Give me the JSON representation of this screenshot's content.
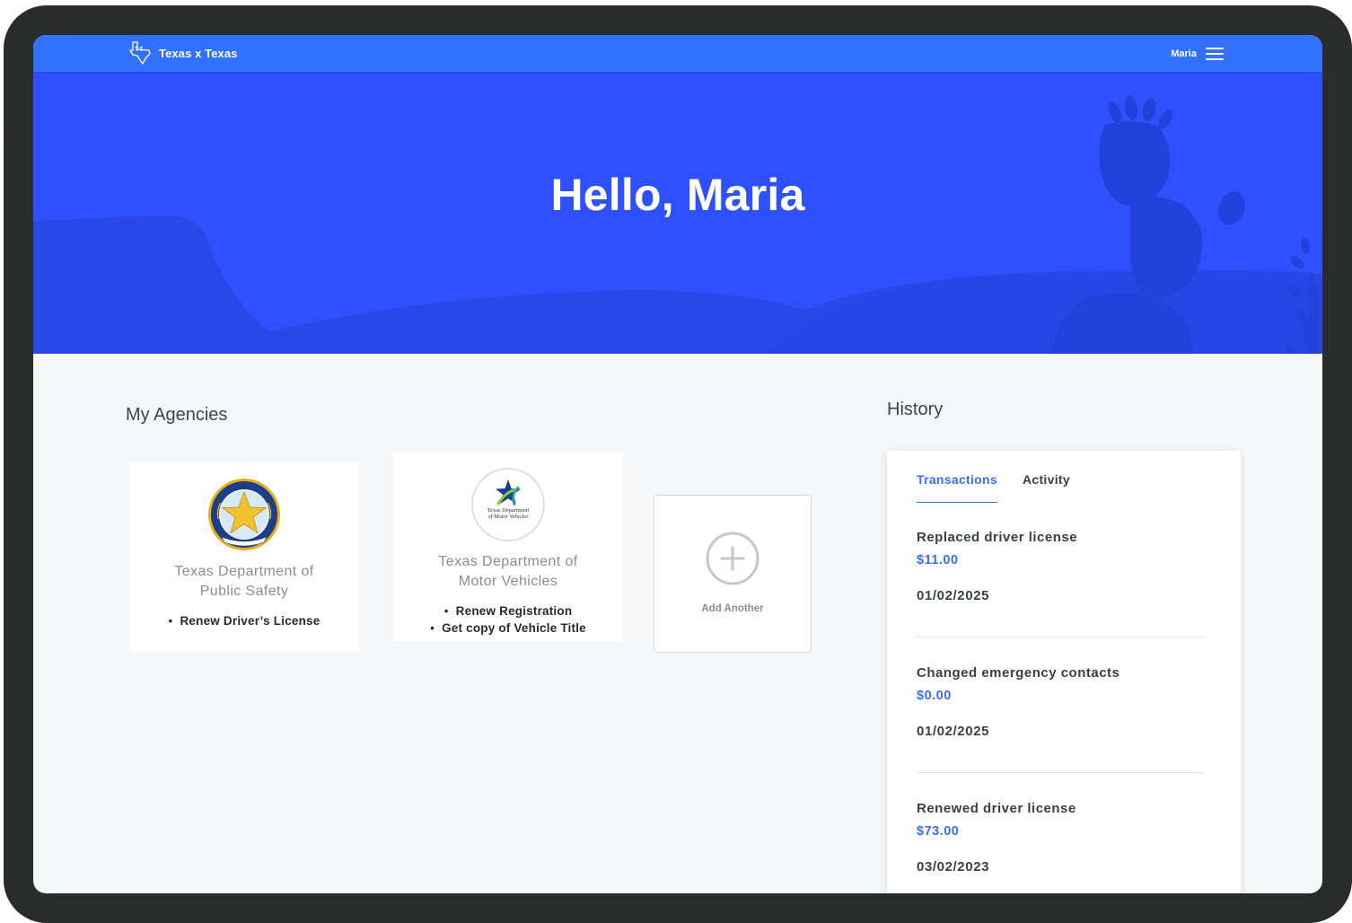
{
  "app": {
    "brand": "Texas x Texas",
    "user_name": "Maria"
  },
  "hero": {
    "greeting": "Hello, Maria"
  },
  "agencies": {
    "title": "My Agencies",
    "items": [
      {
        "name": "Texas Department of Public Safety",
        "logo": "texas-dps-seal-icon",
        "services": [
          "Renew Driver’s License"
        ]
      },
      {
        "name": "Texas Department of Motor Vehicles",
        "logo": "texas-dmv-logo-icon",
        "logo_text": [
          "Texas Department",
          "of Motor Vehicles"
        ],
        "services": [
          "Renew Registration",
          "Get copy of Vehicle Title"
        ]
      }
    ],
    "add_label": "Add Another"
  },
  "history": {
    "title": "History",
    "tabs": [
      {
        "label": "Transactions",
        "active": true
      },
      {
        "label": "Activity",
        "active": false
      }
    ],
    "transactions": [
      {
        "title": "Replaced driver license",
        "amount": "$11.00",
        "date": "01/02/2025"
      },
      {
        "title": "Changed emergency contacts",
        "amount": "$0.00",
        "date": "01/02/2025"
      },
      {
        "title": "Renewed driver license",
        "amount": "$73.00",
        "date": "03/02/2023"
      }
    ]
  },
  "colors": {
    "nav_blue": "#3271fd",
    "hero_blue": "#2f50ff",
    "accent_blue": "#3a6ff0",
    "device_frame": "#2a2c2b"
  }
}
